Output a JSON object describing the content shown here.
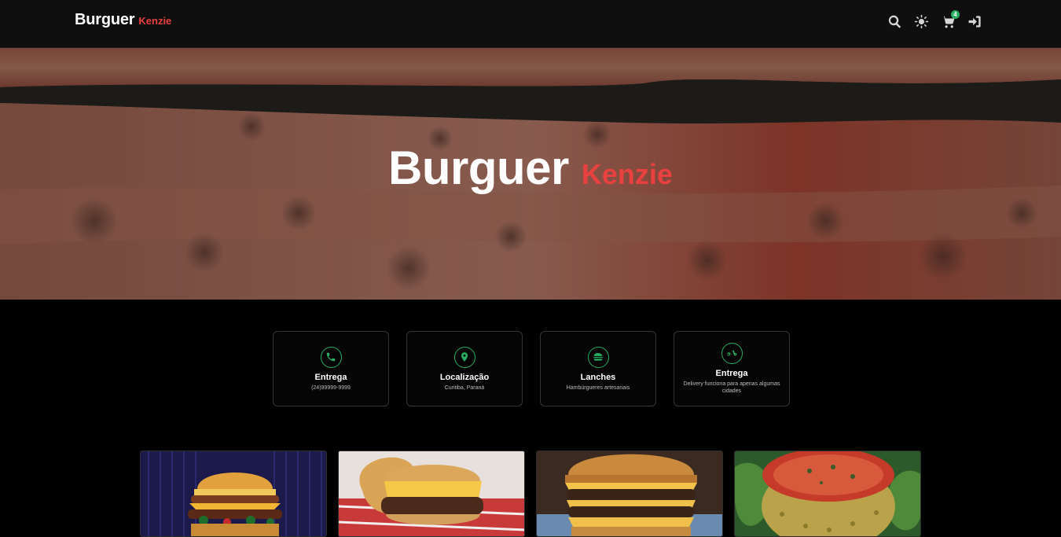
{
  "header": {
    "logo_main": "Burguer",
    "logo_sub": "Kenzie",
    "icons": [
      "search-icon",
      "theme-toggle-icon",
      "cart-icon",
      "login-icon"
    ],
    "cart_count": "4"
  },
  "hero": {
    "title_main": "Burguer",
    "title_sub": "Kenzie"
  },
  "info_cards": [
    {
      "icon": "phone-icon",
      "title": "Entrega",
      "text": "(24)99999-9999"
    },
    {
      "icon": "location-pin-icon",
      "title": "Localização",
      "text": "Curitiba, Paraná"
    },
    {
      "icon": "burger-icon",
      "title": "Lanches",
      "text": "Hambúrgueres artesanais"
    },
    {
      "icon": "scooter-icon",
      "title": "Entrega",
      "text": "Delivery funciona para apenas algumas cidades"
    }
  ],
  "products": [
    {
      "image": "burger-photo-1"
    },
    {
      "image": "burger-photo-2"
    },
    {
      "image": "burger-photo-3"
    },
    {
      "image": "burger-photo-4"
    }
  ],
  "colors": {
    "accent_red": "#e8413f",
    "accent_green": "#27ae60",
    "header_bg": "#0f0f0f",
    "page_bg": "#000000"
  }
}
